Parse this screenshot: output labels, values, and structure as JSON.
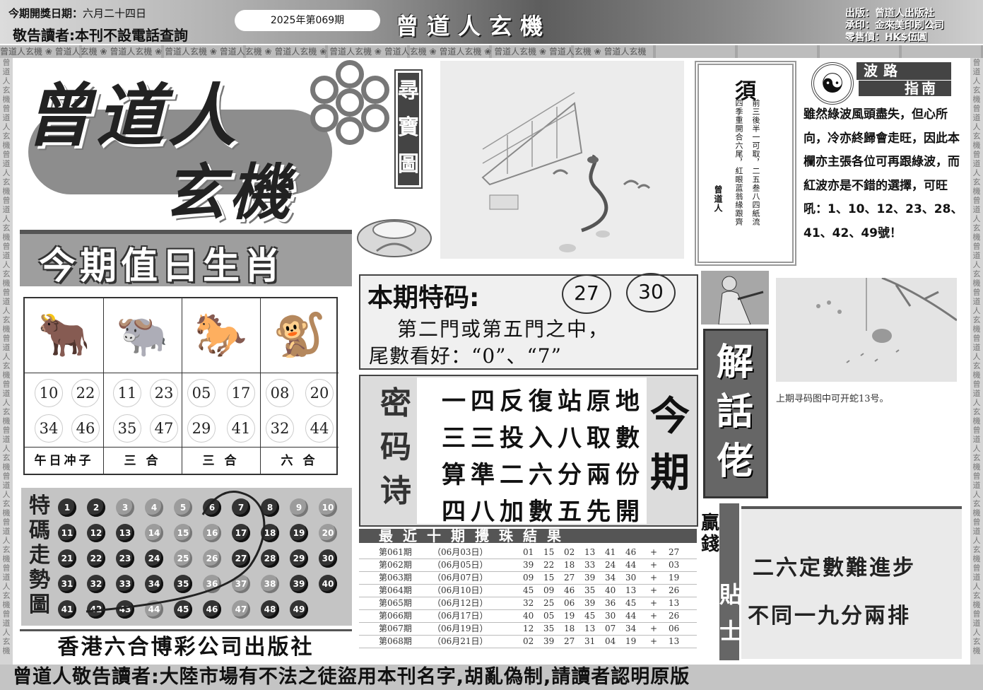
{
  "header": {
    "draw_date_label": "今期開獎日期：",
    "draw_date": "六月二十四日",
    "notice": "敬告讀者:本刊不設電話查詢",
    "issue": "2025年第069期",
    "brand": "曾道人玄機",
    "publisher_line": "出版：曾道人出版社",
    "printer_line": "承印：金來美印刷公司",
    "price_line": "零售價：HK$伍圓"
  },
  "pattern_text": "曾道人玄機",
  "logo": {
    "line1": "曾道人",
    "line2": "玄機",
    "treasure_label": "尋寶圖"
  },
  "zodiac": {
    "title": "今期值日生肖",
    "columns": [
      {
        "animal_icon": "ox-icon",
        "glyph": "🐂",
        "numbers": [
          "10",
          "22",
          "34",
          "46"
        ],
        "relation": "午日冲子"
      },
      {
        "animal_icon": "ox-icon",
        "glyph": "🐃",
        "numbers": [
          "11",
          "23",
          "35",
          "47"
        ],
        "relation": "三 合"
      },
      {
        "animal_icon": "horse-icon",
        "glyph": "🐎",
        "numbers": [
          "05",
          "17",
          "29",
          "41"
        ],
        "relation": "三 合"
      },
      {
        "animal_icon": "monkey-icon",
        "glyph": "🐒",
        "numbers": [
          "08",
          "20",
          "32",
          "44"
        ],
        "relation": "六 合"
      }
    ]
  },
  "trend": {
    "title": "特碼走勢圖",
    "balls": [
      "1",
      "2",
      "3",
      "4",
      "5",
      "6",
      "7",
      "8",
      "9",
      "10",
      "11",
      "12",
      "13",
      "14",
      "15",
      "16",
      "17",
      "18",
      "19",
      "20",
      "21",
      "22",
      "23",
      "24",
      "25",
      "26",
      "27",
      "28",
      "29",
      "30",
      "31",
      "32",
      "33",
      "34",
      "35",
      "36",
      "37",
      "38",
      "39",
      "40",
      "41",
      "42",
      "43",
      "44",
      "45",
      "46",
      "47",
      "48",
      "49"
    ],
    "light_balls": [
      "3",
      "4",
      "5",
      "9",
      "10",
      "14",
      "15",
      "16",
      "20",
      "25",
      "26",
      "36",
      "37",
      "38",
      "44",
      "47"
    ]
  },
  "publisher": "香港六合博彩公司出版社",
  "xu": {
    "title": "須",
    "lines": [
      "前三後半一可取，二五叁八四紙流",
      "四季重開合六尾，紅眼蓝翁緣跟齊"
    ],
    "signature": "曾道人"
  },
  "wave_guide": {
    "title1": "波路",
    "title2": "指南",
    "text": "雖然綠波風頭盡失，但心所向，冷亦終歸會走旺，因此本欄亦主張各位可再跟綠波，而紅波亦是不錯的選擇，可旺吼：1、10、12、23、28、41、42、49號！"
  },
  "special": {
    "title": "本期特码:",
    "numbers": [
      "27",
      "30"
    ],
    "line1": "第二門或第五門之中，",
    "line2": "尾數看好：“0”、“7”"
  },
  "poem": {
    "label": "密码诗",
    "lines": [
      "一四反復站原地",
      "三三投入八取數",
      "算準二六分兩份",
      "四八加數五先開"
    ],
    "side": "今期"
  },
  "results": {
    "title": "最近十期攪珠結果",
    "rows": [
      {
        "issue": "第061期",
        "date": "（06月03日）",
        "nums": [
          "01",
          "15",
          "02",
          "13",
          "41",
          "46"
        ],
        "special": "27"
      },
      {
        "issue": "第062期",
        "date": "（06月05日）",
        "nums": [
          "39",
          "22",
          "18",
          "33",
          "24",
          "44"
        ],
        "special": "03"
      },
      {
        "issue": "第063期",
        "date": "（06月07日）",
        "nums": [
          "09",
          "15",
          "27",
          "39",
          "34",
          "30"
        ],
        "special": "19"
      },
      {
        "issue": "第064期",
        "date": "（06月10日）",
        "nums": [
          "45",
          "09",
          "46",
          "35",
          "40",
          "13"
        ],
        "special": "26"
      },
      {
        "issue": "第065期",
        "date": "（06月12日）",
        "nums": [
          "32",
          "25",
          "06",
          "39",
          "36",
          "45"
        ],
        "special": "13"
      },
      {
        "issue": "第066期",
        "date": "（06月17日）",
        "nums": [
          "40",
          "05",
          "19",
          "45",
          "30",
          "44"
        ],
        "special": "26"
      },
      {
        "issue": "第067期",
        "date": "（06月19日）",
        "nums": [
          "12",
          "35",
          "18",
          "13",
          "07",
          "34"
        ],
        "special": "06"
      },
      {
        "issue": "第068期",
        "date": "（06月21日）",
        "nums": [
          "02",
          "39",
          "27",
          "31",
          "04",
          "19"
        ],
        "special": "13"
      }
    ]
  },
  "jiehua": {
    "title": "解話佬",
    "caption": "上期寻码图中可开蛇13号。"
  },
  "tip": {
    "label1": "贏錢",
    "label2": "貼士",
    "line1": "二六定數難進步",
    "line2": "不同一九分兩排"
  },
  "bottom": "曾道人敬告讀者:大陸市場有不法之徒盜用本刊名字,胡亂偽制,請讀者認明原版"
}
